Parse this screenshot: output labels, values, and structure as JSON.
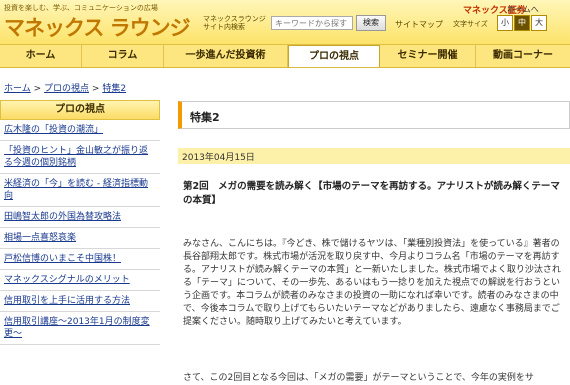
{
  "header": {
    "tagline": "投資を楽しむ、学ぶ、コミュニケーションの広場",
    "logo": "マネックス ラウンジ",
    "site_search_label": "マネックスラウンジ サイト内検索",
    "search_placeholder": "キーワードから探す",
    "search_button": "検索",
    "sitemap": "サイトマップ",
    "font_size_label": "文字サイズ",
    "font_sizes": [
      "小",
      "中",
      "大"
    ],
    "brand": "マネックス証券",
    "brand_home": "ホームへ"
  },
  "nav": {
    "items": [
      "ホーム",
      "コラム",
      "一歩進んだ投資術",
      "プロの視点",
      "セミナー開催",
      "動画コーナー"
    ],
    "active": "プロの視点"
  },
  "breadcrumb": {
    "home": "ホーム",
    "sep1": ">",
    "section": "プロの視点",
    "sep2": ">",
    "current": "特集2"
  },
  "sidebar": {
    "heading": "プロの視点",
    "items": [
      "広木隆の「投資の潮流」",
      "「投資のヒント」金山敏之が振り返る今週の個別銘柄",
      "米経済の「今」を読む - 経済指標動向",
      "田嶋智太郎の外国為替攻略法",
      "相場一点喜怒哀楽",
      "戸松信博のいまこそ中国株！",
      "マネックスシグナルのメリット",
      "信用取引を上手に活用する方法",
      "信用取引講座〜2013年1月の制度変更〜"
    ]
  },
  "article": {
    "title": "特集2",
    "date": "2013年04月15日",
    "headline": "第2回　メガの需要を読み解く【市場のテーマを再訪する。アナリストが読み解くテーマの本質】",
    "body": "みなさん、こんにちは。『今どき、株で儲けるヤツは、「業種別投資法」を使っている』著者の長谷部翔太郎です。株式市場が活況を取り戻す中、今月よりコラム名「市場のテーマを再訪する。アナリストが読み解くテーマの本質」と一新いたしました。株式市場でよく取り沙汰される「テーマ」について、その一歩先、あるいはもう一捻りを加えた視点での解説を行おうという企画です。本コラムが読者のみなさまの投資の一助になれば幸いです。読者のみなさまの中で、今後本コラムで取り上げてもらいたいテーマなどがありましたら、遠慮なく事務局までご提案ください。随時取り上げてみたいと考えています。",
    "body_cut": "さて、この2回目となる今回は、「メガの需要」がテーマということで、今年の実例をサ"
  },
  "colors": {
    "header_bg": "#fde36a",
    "accent": "#f29a00",
    "link": "#1a3a8f",
    "brand": "#c03000"
  }
}
